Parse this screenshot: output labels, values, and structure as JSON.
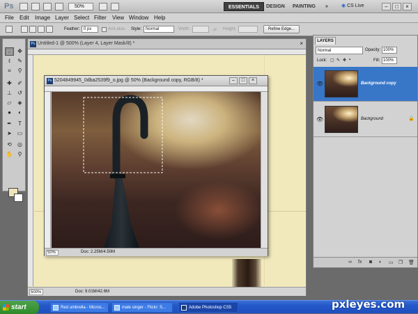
{
  "app": {
    "logo": "Ps",
    "zoom": "50%",
    "workspaces": [
      "ESSENTIALS",
      "DESIGN",
      "PAINTING"
    ],
    "more": "»",
    "cs_live": "CS Live"
  },
  "menu": [
    "File",
    "Edit",
    "Image",
    "Layer",
    "Select",
    "Filter",
    "View",
    "Window",
    "Help"
  ],
  "options": {
    "feather_label": "Feather:",
    "feather_value": "0 px",
    "antialias_label": "Anti-alias",
    "style_label": "Style:",
    "style_value": "Normal",
    "width_label": "Width:",
    "height_label": "Height:",
    "refine_edge": "Refine Edge..."
  },
  "untitled_doc": {
    "title": "Untitled-1 @ 500% (Layer 4, Layer Mask/8) *",
    "zoom": "500%",
    "doc_size": "Doc: 9.01M/42.6M"
  },
  "photo_doc": {
    "title": "5204849945_0dba2539f9_o.jpg @ 50% (Background copy, RGB/8) *",
    "zoom": "50%",
    "doc_size": "Doc: 2.25M/4.50M"
  },
  "layers_panel": {
    "tab": "LAYERS",
    "blend_mode": "Normal",
    "opacity_label": "Opacity:",
    "opacity": "100%",
    "lock_label": "Lock:",
    "fill_label": "Fill:",
    "fill": "100%",
    "layers": [
      {
        "name": "Background copy",
        "selected": true
      },
      {
        "name": "Background",
        "selected": false,
        "locked": true
      }
    ]
  },
  "taskbar": {
    "start": "start",
    "tasks": [
      "Red umbrella - Micros...",
      "male singer - Flickr: S...",
      "Adobe Photoshop CS5"
    ]
  },
  "watermark": "pxleyes.com",
  "colors": {
    "selection_blue": "#3876c8",
    "foreground": "#efe4b8",
    "background": "#ffffff"
  }
}
